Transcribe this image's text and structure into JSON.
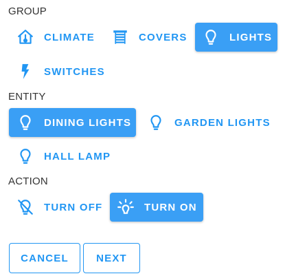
{
  "sections": {
    "group": {
      "label": "GROUP",
      "options": [
        {
          "label": "CLIMATE",
          "icon": "home-thermometer-icon",
          "selected": false
        },
        {
          "label": "COVERS",
          "icon": "blinds-icon",
          "selected": false
        },
        {
          "label": "LIGHTS",
          "icon": "lightbulb-icon",
          "selected": true
        },
        {
          "label": "SWITCHES",
          "icon": "flash-icon",
          "selected": false
        }
      ]
    },
    "entity": {
      "label": "ENTITY",
      "options": [
        {
          "label": "DINING LIGHTS",
          "icon": "lightbulb-icon",
          "selected": true
        },
        {
          "label": "GARDEN LIGHTS",
          "icon": "lightbulb-icon",
          "selected": false
        },
        {
          "label": "HALL LAMP",
          "icon": "lightbulb-icon",
          "selected": false
        }
      ]
    },
    "action": {
      "label": "ACTION",
      "options": [
        {
          "label": "TURN OFF",
          "icon": "lightbulb-off-icon",
          "selected": false
        },
        {
          "label": "TURN ON",
          "icon": "lightbulb-on-icon",
          "selected": true
        }
      ]
    }
  },
  "buttons": {
    "cancel": "CANCEL",
    "next": "NEXT"
  },
  "colors": {
    "accent": "#2196f3",
    "selected_background": "#3a9ff5",
    "selected_text": "#ffffff",
    "section_label": "#333333"
  }
}
